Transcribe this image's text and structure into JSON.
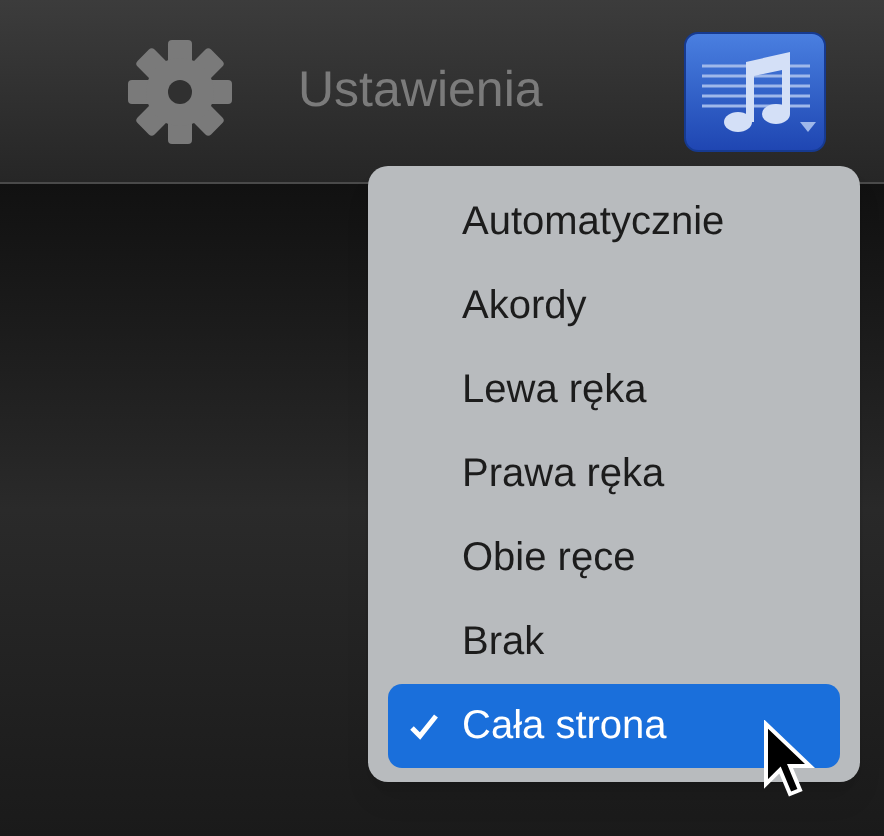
{
  "toolbar": {
    "settings_label": "Ustawienia"
  },
  "menu": {
    "items": [
      {
        "label": "Automatycznie",
        "selected": false
      },
      {
        "label": "Akordy",
        "selected": false
      },
      {
        "label": "Lewa ręka",
        "selected": false
      },
      {
        "label": "Prawa ręka",
        "selected": false
      },
      {
        "label": "Obie ręce",
        "selected": false
      },
      {
        "label": "Brak",
        "selected": false
      },
      {
        "label": "Cała strona",
        "selected": true
      }
    ]
  }
}
